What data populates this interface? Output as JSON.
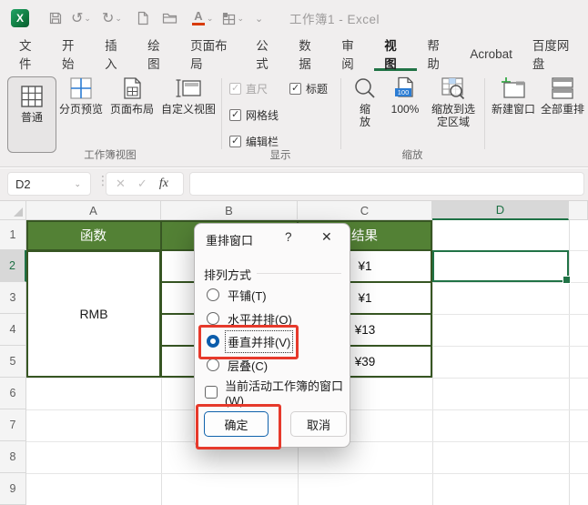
{
  "app": {
    "title": "工作簿1 - Excel"
  },
  "qat": {
    "icons": [
      "excel-logo",
      "save",
      "undo",
      "redo",
      "new-file",
      "open-folder",
      "font-color",
      "borders",
      "more-commands"
    ]
  },
  "ribbon": {
    "tabs": [
      {
        "label": "文件"
      },
      {
        "label": "开始"
      },
      {
        "label": "插入"
      },
      {
        "label": "绘图"
      },
      {
        "label": "页面布局"
      },
      {
        "label": "公式"
      },
      {
        "label": "数据"
      },
      {
        "label": "审阅"
      },
      {
        "label": "视图",
        "active": true
      },
      {
        "label": "帮助"
      },
      {
        "label": "Acrobat"
      },
      {
        "label": "百度网盘"
      }
    ],
    "workbook_views": {
      "label": "工作簿视图",
      "normal": "普通",
      "page_break": "分页预览",
      "page_layout": "页面布局",
      "custom_views": "自定义视图"
    },
    "show": {
      "label": "显示",
      "ruler": "直尺",
      "headings": "标题",
      "gridlines": "网格线",
      "formula_bar": "编辑栏",
      "ruler_checked": true,
      "ruler_disabled": true,
      "headings_checked": true,
      "gridlines_checked": true,
      "formula_bar_checked": true
    },
    "zoom": {
      "label": "缩放",
      "zoom": "缩放",
      "hundred": "100%",
      "hundred_badge": "100",
      "zoom_selection": "缩放到选定区域"
    },
    "window": {
      "new_window": "新建窗口",
      "arrange_all": "全部重排"
    }
  },
  "formula_bar": {
    "name_box": "D2",
    "fx": "fx",
    "formula": ""
  },
  "sheet": {
    "col_headers": [
      "A",
      "B",
      "C",
      "D"
    ],
    "row_headers": [
      "1",
      "2",
      "3",
      "4",
      "5",
      "6",
      "7",
      "8",
      "9"
    ],
    "selected_cell": "D2",
    "cells": {
      "a1": "函数",
      "c1": "结果",
      "merged_a": "RMB",
      "c2": "¥1",
      "c3": "¥1",
      "c4": "¥13",
      "c5": "¥39"
    }
  },
  "dialog": {
    "title": "重排窗口",
    "help": "?",
    "close": "✕",
    "group_label": "排列方式",
    "radios": [
      {
        "pre": "平铺(",
        "key": "T",
        "post": ")",
        "selected": false
      },
      {
        "pre": "水平并排(",
        "key": "O",
        "post": ")",
        "selected": false
      },
      {
        "pre": "垂直并排(",
        "key": "V",
        "post": ")",
        "selected": true
      },
      {
        "pre": "层叠(",
        "key": "C",
        "post": ")",
        "selected": false
      }
    ],
    "active_checkbox": {
      "pre": "当前活动工作簿的窗口(",
      "key": "W",
      "post": ")",
      "checked": false
    },
    "ok": "确定",
    "cancel": "取消"
  },
  "colors": {
    "excel_green": "#217346",
    "header_fill": "#538135",
    "table_border": "#375623",
    "accent_blue": "#0b5cab",
    "annotation_red": "#e6392b"
  }
}
